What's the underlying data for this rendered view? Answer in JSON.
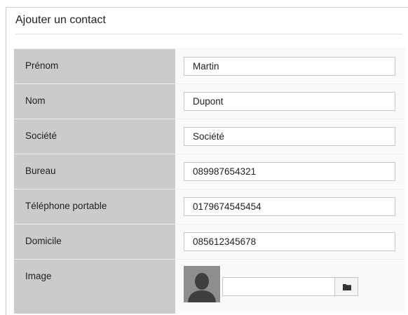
{
  "header": {
    "title": "Ajouter un contact"
  },
  "form": {
    "fields": [
      {
        "label": "Prénom",
        "value": "Martin"
      },
      {
        "label": "Nom",
        "value": "Dupont"
      },
      {
        "label": "Société",
        "value": "Société"
      },
      {
        "label": "Bureau",
        "value": "089987654321"
      },
      {
        "label": "Téléphone portable",
        "value": "0179674545454"
      },
      {
        "label": "Domicile",
        "value": "085612345678"
      }
    ],
    "image": {
      "label": "Image",
      "file_value": "",
      "avatar_icon": "user-silhouette-icon",
      "browse_icon": "folder-icon"
    }
  }
}
